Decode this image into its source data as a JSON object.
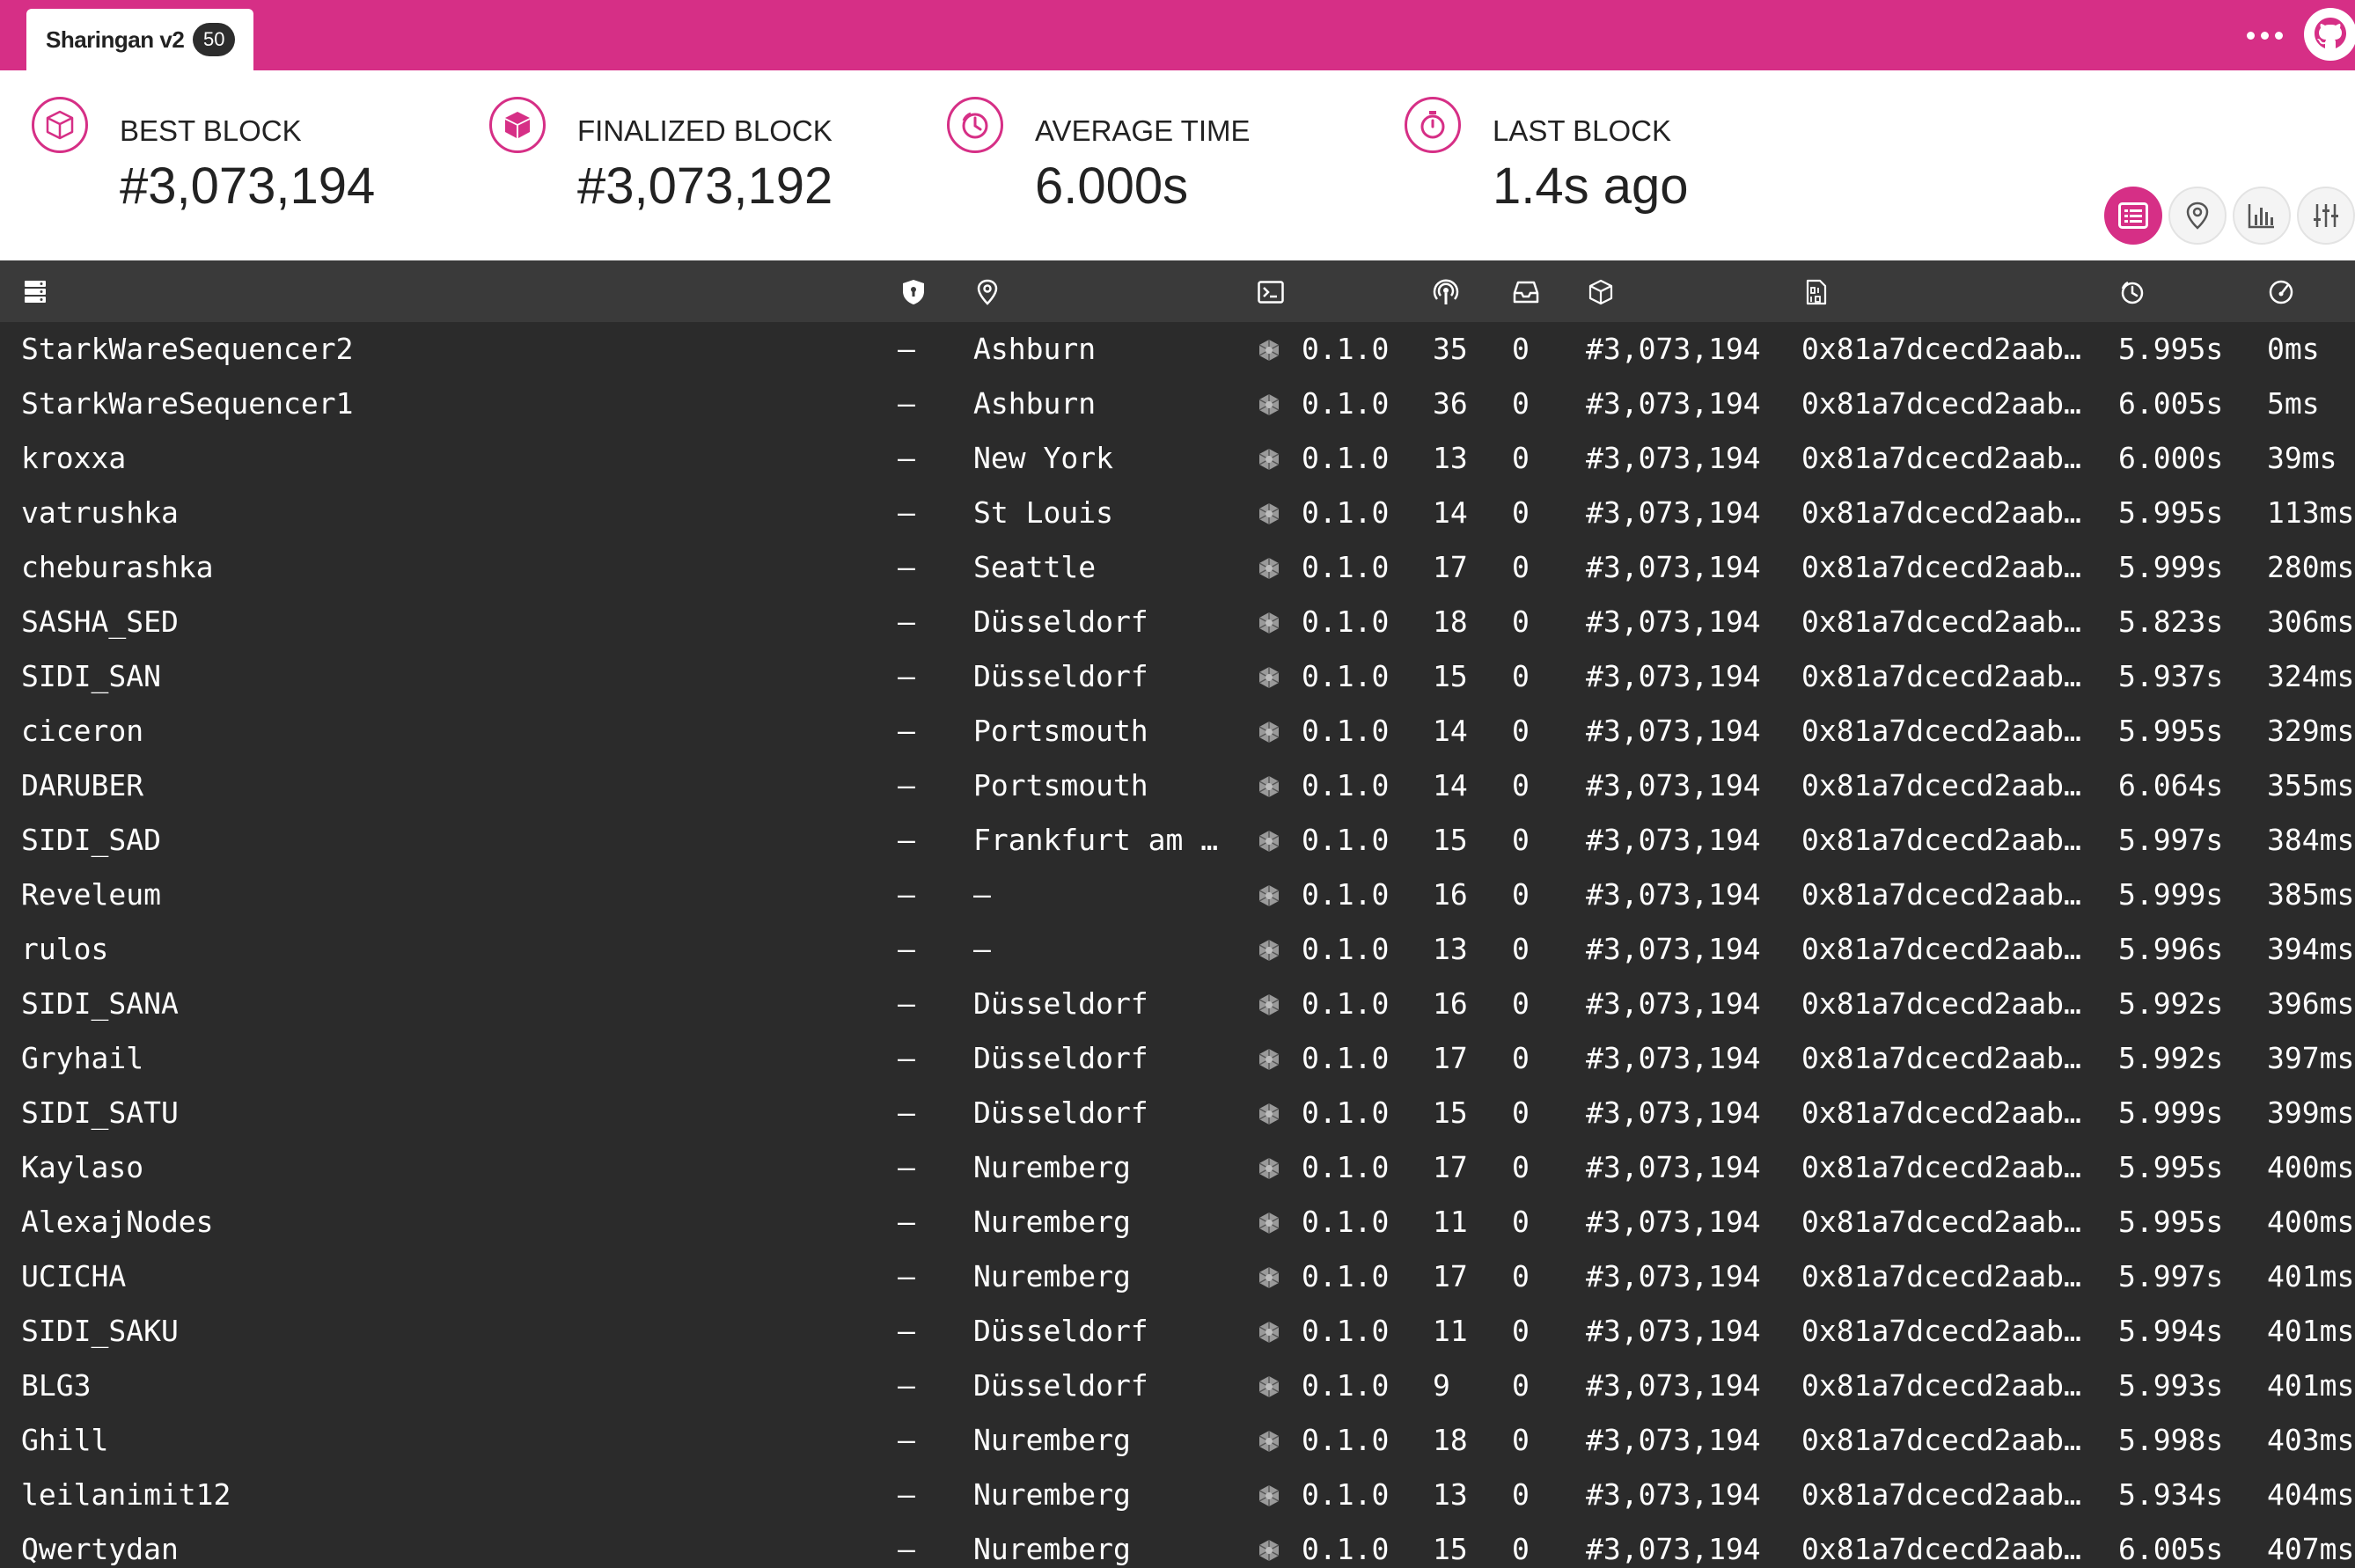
{
  "app": {
    "tab_name": "Sharingan v2",
    "node_count": "50",
    "more_icon": "ellipsis-icon",
    "github_icon": "github-icon",
    "accent_color": "#d62f86"
  },
  "stats": [
    {
      "label": "BEST BLOCK",
      "value": "#3,073,194",
      "icon": "cube-outline-icon"
    },
    {
      "label": "FINALIZED BLOCK",
      "value": "#3,073,192",
      "icon": "cube-filled-icon"
    },
    {
      "label": "AVERAGE TIME",
      "value": "6.000s",
      "icon": "timer-icon"
    },
    {
      "label": "LAST BLOCK",
      "value": "1.4s ago",
      "icon": "stopwatch-icon"
    }
  ],
  "views": [
    {
      "name": "list-view",
      "icon": "list-icon",
      "active": true
    },
    {
      "name": "map-view",
      "icon": "map-pin-icon",
      "active": false
    },
    {
      "name": "stats-view",
      "icon": "bar-chart-icon",
      "active": false
    },
    {
      "name": "settings-view",
      "icon": "sliders-icon",
      "active": false
    }
  ],
  "columns": [
    {
      "key": "name",
      "icon": "server-icon"
    },
    {
      "key": "validator",
      "icon": "shield-icon"
    },
    {
      "key": "location",
      "icon": "location-pin-icon"
    },
    {
      "key": "implementation",
      "icon": "terminal-icon"
    },
    {
      "key": "peers",
      "icon": "broadcast-icon"
    },
    {
      "key": "transactions",
      "icon": "inbox-icon"
    },
    {
      "key": "block",
      "icon": "cube-icon"
    },
    {
      "key": "hash",
      "icon": "file-binary-icon"
    },
    {
      "key": "block_time",
      "icon": "timer-icon"
    },
    {
      "key": "propagation",
      "icon": "gauge-icon"
    }
  ],
  "rows": [
    {
      "name": "StarkWareSequencer2",
      "validator": "–",
      "location": "Ashburn",
      "version": "0.1.0",
      "peers": "35",
      "txs": "0",
      "block": "#3,073,194",
      "hash": "0x81a7dcecd2aab…",
      "time": "5.995s",
      "prop": "0ms"
    },
    {
      "name": "StarkWareSequencer1",
      "validator": "–",
      "location": "Ashburn",
      "version": "0.1.0",
      "peers": "36",
      "txs": "0",
      "block": "#3,073,194",
      "hash": "0x81a7dcecd2aab…",
      "time": "6.005s",
      "prop": "5ms"
    },
    {
      "name": "kroxxa",
      "validator": "–",
      "location": "New York",
      "version": "0.1.0",
      "peers": "13",
      "txs": "0",
      "block": "#3,073,194",
      "hash": "0x81a7dcecd2aab…",
      "time": "6.000s",
      "prop": "39ms"
    },
    {
      "name": "vatrushka",
      "validator": "–",
      "location": "St Louis",
      "version": "0.1.0",
      "peers": "14",
      "txs": "0",
      "block": "#3,073,194",
      "hash": "0x81a7dcecd2aab…",
      "time": "5.995s",
      "prop": "113ms"
    },
    {
      "name": "cheburashka",
      "validator": "–",
      "location": "Seattle",
      "version": "0.1.0",
      "peers": "17",
      "txs": "0",
      "block": "#3,073,194",
      "hash": "0x81a7dcecd2aab…",
      "time": "5.999s",
      "prop": "280ms"
    },
    {
      "name": "SASHA_SED",
      "validator": "–",
      "location": "Düsseldorf",
      "version": "0.1.0",
      "peers": "18",
      "txs": "0",
      "block": "#3,073,194",
      "hash": "0x81a7dcecd2aab…",
      "time": "5.823s",
      "prop": "306ms"
    },
    {
      "name": "SIDI_SAN",
      "validator": "–",
      "location": "Düsseldorf",
      "version": "0.1.0",
      "peers": "15",
      "txs": "0",
      "block": "#3,073,194",
      "hash": "0x81a7dcecd2aab…",
      "time": "5.937s",
      "prop": "324ms"
    },
    {
      "name": "ciceron",
      "validator": "–",
      "location": "Portsmouth",
      "version": "0.1.0",
      "peers": "14",
      "txs": "0",
      "block": "#3,073,194",
      "hash": "0x81a7dcecd2aab…",
      "time": "5.995s",
      "prop": "329ms"
    },
    {
      "name": "DARUBER",
      "validator": "–",
      "location": "Portsmouth",
      "version": "0.1.0",
      "peers": "14",
      "txs": "0",
      "block": "#3,073,194",
      "hash": "0x81a7dcecd2aab…",
      "time": "6.064s",
      "prop": "355ms"
    },
    {
      "name": "SIDI_SAD",
      "validator": "–",
      "location": "Frankfurt am …",
      "version": "0.1.0",
      "peers": "15",
      "txs": "0",
      "block": "#3,073,194",
      "hash": "0x81a7dcecd2aab…",
      "time": "5.997s",
      "prop": "384ms"
    },
    {
      "name": "Reveleum",
      "validator": "–",
      "location": "–",
      "version": "0.1.0",
      "peers": "16",
      "txs": "0",
      "block": "#3,073,194",
      "hash": "0x81a7dcecd2aab…",
      "time": "5.999s",
      "prop": "385ms"
    },
    {
      "name": "rulos",
      "validator": "–",
      "location": "–",
      "version": "0.1.0",
      "peers": "13",
      "txs": "0",
      "block": "#3,073,194",
      "hash": "0x81a7dcecd2aab…",
      "time": "5.996s",
      "prop": "394ms"
    },
    {
      "name": "SIDI_SANA",
      "validator": "–",
      "location": "Düsseldorf",
      "version": "0.1.0",
      "peers": "16",
      "txs": "0",
      "block": "#3,073,194",
      "hash": "0x81a7dcecd2aab…",
      "time": "5.992s",
      "prop": "396ms"
    },
    {
      "name": "Gryhail",
      "validator": "–",
      "location": "Düsseldorf",
      "version": "0.1.0",
      "peers": "17",
      "txs": "0",
      "block": "#3,073,194",
      "hash": "0x81a7dcecd2aab…",
      "time": "5.992s",
      "prop": "397ms"
    },
    {
      "name": "SIDI_SATU",
      "validator": "–",
      "location": "Düsseldorf",
      "version": "0.1.0",
      "peers": "15",
      "txs": "0",
      "block": "#3,073,194",
      "hash": "0x81a7dcecd2aab…",
      "time": "5.999s",
      "prop": "399ms"
    },
    {
      "name": "Kaylaso",
      "validator": "–",
      "location": "Nuremberg",
      "version": "0.1.0",
      "peers": "17",
      "txs": "0",
      "block": "#3,073,194",
      "hash": "0x81a7dcecd2aab…",
      "time": "5.995s",
      "prop": "400ms"
    },
    {
      "name": "AlexajNodes",
      "validator": "–",
      "location": "Nuremberg",
      "version": "0.1.0",
      "peers": "11",
      "txs": "0",
      "block": "#3,073,194",
      "hash": "0x81a7dcecd2aab…",
      "time": "5.995s",
      "prop": "400ms"
    },
    {
      "name": "UCICHA",
      "validator": "–",
      "location": "Nuremberg",
      "version": "0.1.0",
      "peers": "17",
      "txs": "0",
      "block": "#3,073,194",
      "hash": "0x81a7dcecd2aab…",
      "time": "5.997s",
      "prop": "401ms"
    },
    {
      "name": "SIDI_SAKU",
      "validator": "–",
      "location": "Düsseldorf",
      "version": "0.1.0",
      "peers": "11",
      "txs": "0",
      "block": "#3,073,194",
      "hash": "0x81a7dcecd2aab…",
      "time": "5.994s",
      "prop": "401ms"
    },
    {
      "name": "BLG3",
      "validator": "–",
      "location": "Düsseldorf",
      "version": "0.1.0",
      "peers": "9",
      "txs": "0",
      "block": "#3,073,194",
      "hash": "0x81a7dcecd2aab…",
      "time": "5.993s",
      "prop": "401ms"
    },
    {
      "name": "Ghill",
      "validator": "–",
      "location": "Nuremberg",
      "version": "0.1.0",
      "peers": "18",
      "txs": "0",
      "block": "#3,073,194",
      "hash": "0x81a7dcecd2aab…",
      "time": "5.998s",
      "prop": "403ms"
    },
    {
      "name": "leilanimit12",
      "validator": "–",
      "location": "Nuremberg",
      "version": "0.1.0",
      "peers": "13",
      "txs": "0",
      "block": "#3,073,194",
      "hash": "0x81a7dcecd2aab…",
      "time": "5.934s",
      "prop": "404ms"
    },
    {
      "name": "Qwertydan",
      "validator": "–",
      "location": "Nuremberg",
      "version": "0.1.0",
      "peers": "15",
      "txs": "0",
      "block": "#3,073,194",
      "hash": "0x81a7dcecd2aab…",
      "time": "6.005s",
      "prop": "407ms"
    }
  ]
}
